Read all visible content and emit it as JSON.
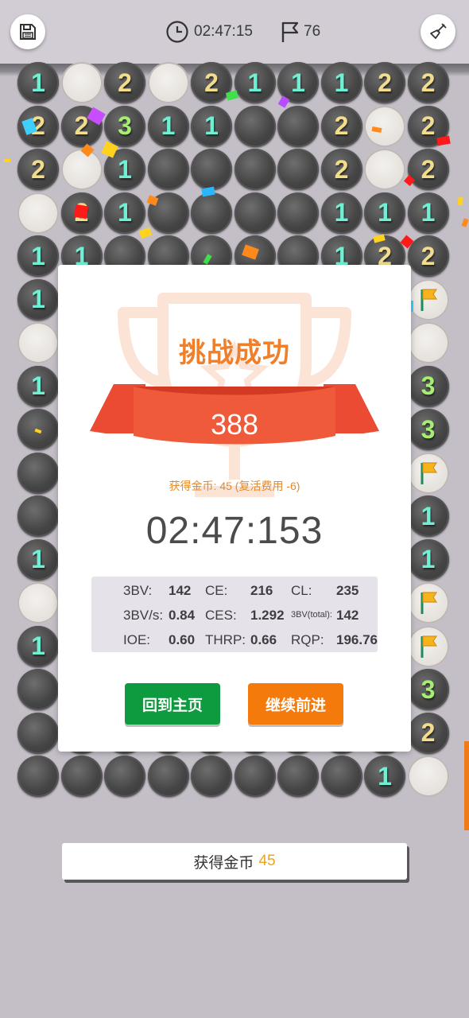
{
  "header": {
    "save_icon": "save-disk-icon",
    "timer_icon": "clock-icon",
    "timer": "02:47:15",
    "flag_icon": "flag-icon",
    "flags": "76",
    "shovel_icon": "shovel-icon"
  },
  "board": {
    "rows": [
      [
        "1",
        "o",
        "2",
        "o",
        "2",
        "1",
        "1",
        "1",
        "2",
        "2"
      ],
      [
        "2",
        "2",
        "3",
        "1",
        "1",
        "c",
        "c",
        "2",
        "o",
        "2"
      ],
      [
        "2",
        "o",
        "1",
        "c",
        "c",
        "c",
        "c",
        "2",
        "o",
        "2"
      ],
      [
        "o",
        "2",
        "1",
        "c",
        "c",
        "c",
        "c",
        "1",
        "1",
        "1"
      ],
      [
        "1",
        "1",
        "c",
        "c",
        "c",
        "c",
        "c",
        "1",
        "2",
        "2"
      ],
      [
        "1",
        "c",
        "c",
        "c",
        "c",
        "c",
        "c",
        "c",
        "c",
        "F"
      ],
      [
        "o",
        "c",
        "c",
        "c",
        "c",
        "c",
        "c",
        "c",
        "c",
        "o"
      ],
      [
        "1",
        "c",
        "c",
        "c",
        "c",
        "c",
        "c",
        "c",
        "c",
        "3"
      ],
      [
        "c",
        "c",
        "c",
        "c",
        "c",
        "c",
        "c",
        "c",
        "c",
        "3"
      ],
      [
        "c",
        "c",
        "c",
        "c",
        "c",
        "c",
        "c",
        "c",
        "c",
        "F"
      ],
      [
        "c",
        "c",
        "c",
        "c",
        "c",
        "c",
        "c",
        "c",
        "c",
        "1"
      ],
      [
        "1",
        "c",
        "c",
        "c",
        "c",
        "c",
        "c",
        "c",
        "c",
        "1"
      ],
      [
        "o",
        "c",
        "c",
        "c",
        "c",
        "c",
        "c",
        "c",
        "c",
        "F"
      ],
      [
        "1",
        "c",
        "c",
        "c",
        "c",
        "c",
        "c",
        "c",
        "c",
        "F"
      ],
      [
        "c",
        "c",
        "c",
        "c",
        "c",
        "c",
        "c",
        "c",
        "c",
        "3"
      ],
      [
        "c",
        "c",
        "c",
        "c",
        "c",
        "c",
        "c",
        "c",
        "c",
        "2"
      ],
      [
        "c",
        "c",
        "c",
        "c",
        "c",
        "c",
        "c",
        "c",
        "1",
        "o"
      ]
    ],
    "number_colors": {
      "1": "#6ff0d4",
      "2": "#f2dd8c",
      "3": "#a6ee72"
    }
  },
  "dialog": {
    "title": "挑战成功",
    "score": "388",
    "coins_line": "获得金币: 45 (复活费用 -6)",
    "time": "02:47:153",
    "stats": {
      "bv_label": "3BV:",
      "bv": "142",
      "ce_label": "CE:",
      "ce": "216",
      "cl_label": "CL:",
      "cl": "235",
      "bvs_label": "3BV/s:",
      "bvs": "0.84",
      "ces_label": "CES:",
      "ces": "1.292",
      "bvt_label": "3BV(total):",
      "bvt": "142",
      "ioe_label": "IOE:",
      "ioe": "0.60",
      "thrp_label": "THRP:",
      "thrp": "0.66",
      "rqp_label": "RQP:",
      "rqp": "196.76"
    },
    "home_button": "回到主页",
    "continue_button": "继续前进"
  },
  "footer": {
    "coins_label": "获得金币",
    "coins_value": "45"
  },
  "colors": {
    "home_button": "#0e9a3e",
    "continue_button": "#f57a0c",
    "ribbon": "#ef5a3a",
    "title": "#f07f2c",
    "coins_value": "#e8a521"
  }
}
